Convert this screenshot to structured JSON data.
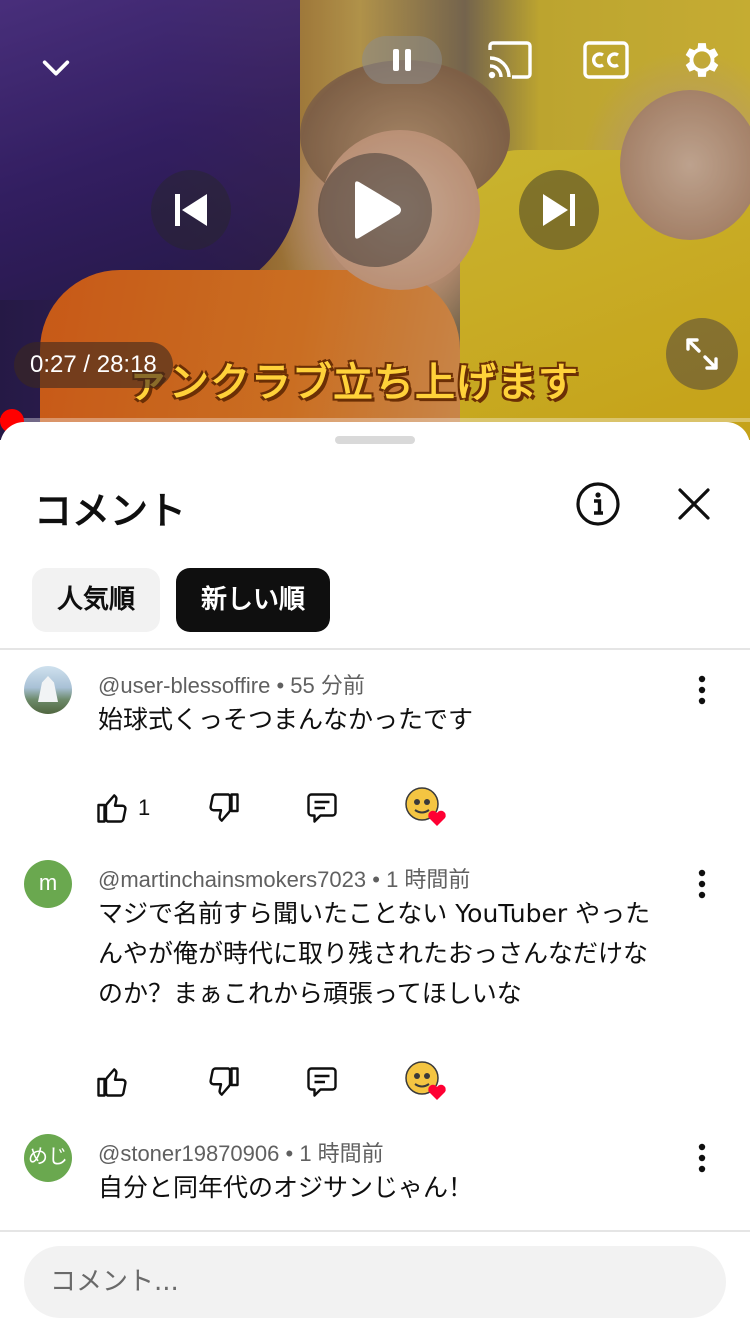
{
  "player": {
    "caption": "ァンクラブ立ち上げます",
    "time": "0:27 / 28:18",
    "progress_fraction": 0.016,
    "icons": {
      "collapse": "chevron-down-icon",
      "pause": "pause-icon",
      "cast": "cast-icon",
      "captions": "cc-icon",
      "settings": "gear-icon",
      "previous": "skip-previous-icon",
      "play": "play-icon",
      "next": "skip-next-icon",
      "fullscreen": "fullscreen-icon"
    }
  },
  "comments_panel": {
    "title": "コメント",
    "sort_chips": [
      {
        "label": "人気順",
        "selected": false
      },
      {
        "label": "新しい順",
        "selected": true
      }
    ],
    "comments": [
      {
        "author": "@user-blessoffire",
        "time": "55 分前",
        "avatar": "photo",
        "text_lines": [
          "始球式くっそつまんなかったです"
        ],
        "like_count": "1",
        "creator_heart": true
      },
      {
        "author": "@martinchainsmokers7023",
        "time": "1 時間前",
        "avatar": "m",
        "text_lines": [
          "マジで名前すら聞いたことない YouTuber やった",
          "んやが俺が時代に取り残されたおっさんなだけな",
          "のか？まぁこれから頑張ってほしいな"
        ],
        "like_count": "",
        "creator_heart": true
      },
      {
        "author": "@stoner19870906",
        "time": "1 時間前",
        "avatar": "めじ",
        "text_lines": [
          "自分と同年代のオジサンじゃん！"
        ],
        "like_count": "",
        "creator_heart": false
      }
    ],
    "input_placeholder": "コメント...",
    "colors": {
      "accent_red": "#ff0000",
      "chip_selected_bg": "#0f0f0f",
      "chip_bg": "#f2f2f2",
      "meta_text": "#606060",
      "avatar_green": "#6aa84f"
    }
  }
}
